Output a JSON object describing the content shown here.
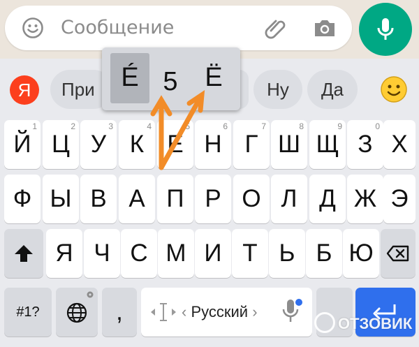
{
  "message_bar": {
    "placeholder": "Сообщение",
    "icons": [
      "emoji-icon",
      "paperclip-icon",
      "camera-icon"
    ]
  },
  "mic_button": {
    "icon": "microphone-icon",
    "color": "#00a884"
  },
  "suggestions": {
    "logo": "Я",
    "items": [
      "При",
      "",
      "Ну",
      "Да"
    ],
    "emoji_icon": "smiley-icon"
  },
  "popup": {
    "chars": [
      "É",
      "5",
      "Ë"
    ],
    "selected_index": 0
  },
  "keys": {
    "row1": [
      {
        "label": "Й",
        "hint": "1"
      },
      {
        "label": "Ц",
        "hint": "2"
      },
      {
        "label": "У",
        "hint": "3"
      },
      {
        "label": "К",
        "hint": "4"
      },
      {
        "label": "Е",
        "hint": "5"
      },
      {
        "label": "Н",
        "hint": "6"
      },
      {
        "label": "Г",
        "hint": "7"
      },
      {
        "label": "Ш",
        "hint": "8"
      },
      {
        "label": "Щ",
        "hint": "9"
      },
      {
        "label": "З",
        "hint": "0"
      },
      {
        "label": "Х",
        "hint": ""
      }
    ],
    "row2": [
      "Ф",
      "Ы",
      "В",
      "А",
      "П",
      "Р",
      "О",
      "Л",
      "Д",
      "Ж",
      "Э"
    ],
    "row3": [
      "Я",
      "Ч",
      "С",
      "М",
      "И",
      "Т",
      "Ь",
      "Б",
      "Ю"
    ],
    "row4": {
      "symbols": "#1?",
      "comma": ",",
      "globe_icon": "globe-icon"
    }
  },
  "space_bar": {
    "language": "Русский",
    "left_chevron": "‹",
    "right_chevron": "›"
  },
  "colors": {
    "enter_key": "#2f6fed",
    "arrow": "#f28c28",
    "yandex": "#fc3f1d"
  },
  "watermark": "ОТЗОВИК"
}
